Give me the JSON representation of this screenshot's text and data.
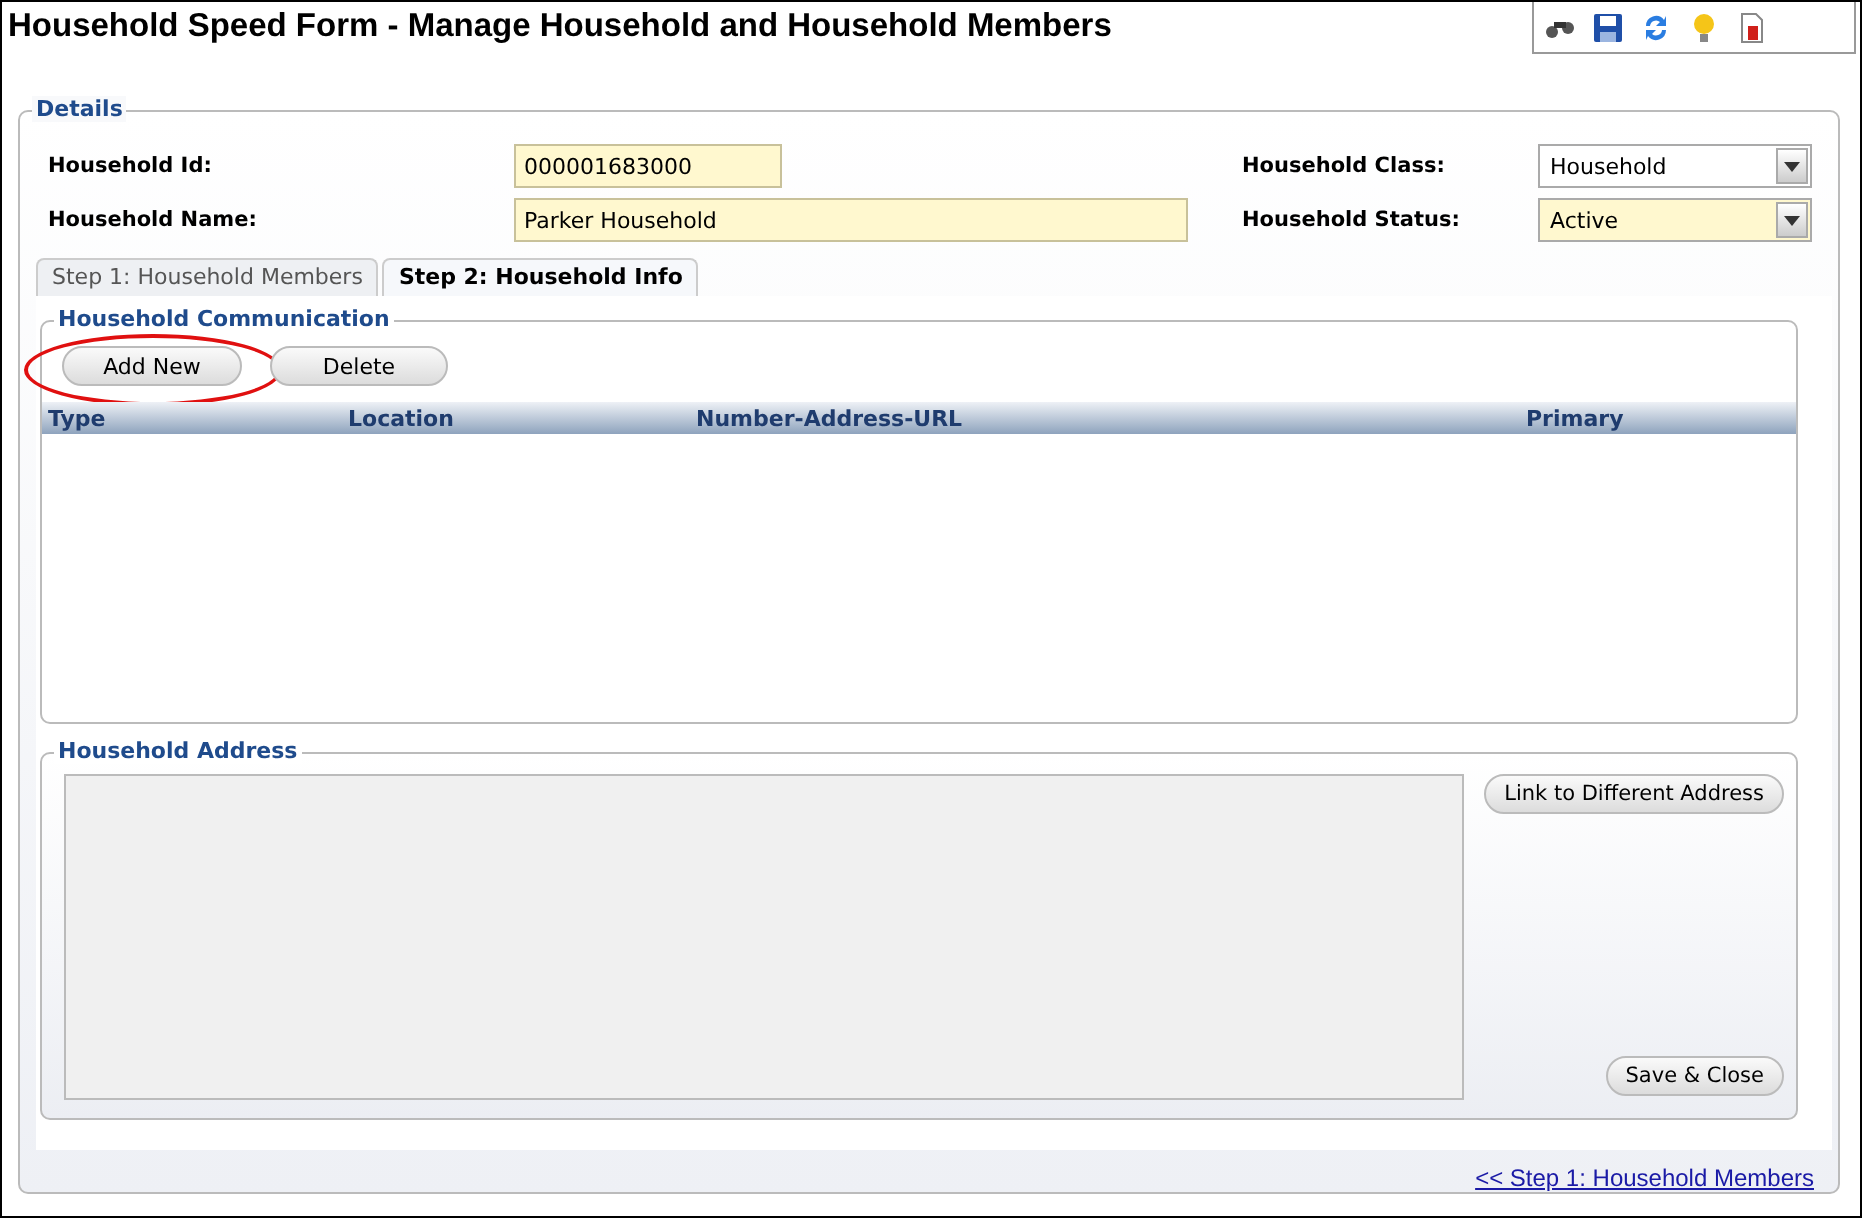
{
  "window": {
    "title": "Household Speed Form - Manage Household and Household Members"
  },
  "details": {
    "legend": "Details",
    "fields": [
      {
        "label": "Household Id:",
        "kind": "short_text",
        "value": "000001683000"
      },
      {
        "label": "Household Class:",
        "kind": "select",
        "value": "Household"
      },
      {
        "label": "Household Name:",
        "kind": "wide_text",
        "value": "Parker Household"
      },
      {
        "label": "Household Status:",
        "kind": "select",
        "value": "Active"
      }
    ]
  },
  "tabs": [
    {
      "label": "Step 1: Household Members",
      "selected": false
    },
    {
      "label": "Step 2: Household Info",
      "selected": true
    }
  ],
  "communication": {
    "legend": "Household Communication",
    "buttons": [
      {
        "label": "Add New",
        "highlighted": true
      },
      {
        "label": "Delete",
        "highlighted": false
      }
    ],
    "table": {
      "columns": [
        "Type",
        "Location",
        "Number-Address-URL",
        "Primary"
      ]
    }
  },
  "address": {
    "legend": "Household Address",
    "buttons": [
      "Link to Different Address",
      "Save & Close"
    ]
  },
  "footer_link": "<< Step 1: Household Members"
}
